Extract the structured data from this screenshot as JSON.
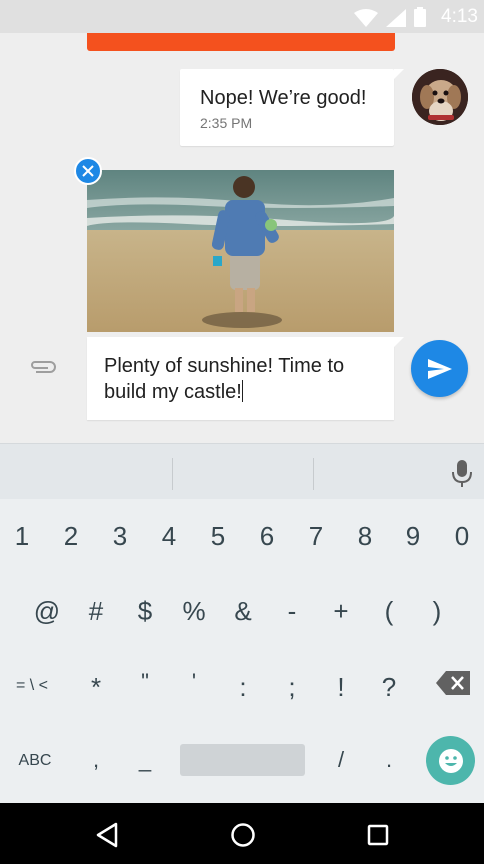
{
  "status_bar": {
    "time": "4:13"
  },
  "conversation": {
    "incoming": {
      "text": "Nope! We’re good!",
      "time": "2:35 PM"
    },
    "attachment": {
      "remove_icon": "close-icon"
    }
  },
  "composer": {
    "text": "Plenty of sunshine! Time to build my castle!",
    "attach_icon": "paperclip-icon",
    "send_icon": "send-icon"
  },
  "keyboard": {
    "row1": [
      "1",
      "2",
      "3",
      "4",
      "5",
      "6",
      "7",
      "8",
      "9",
      "0"
    ],
    "row2": [
      "@",
      "#",
      "$",
      "%",
      "&",
      "-",
      "+",
      "(",
      ")"
    ],
    "row3": [
      "= \\ <",
      "*",
      "\"",
      "'",
      ":",
      ";",
      "!",
      "?"
    ],
    "row4": {
      "abc": "ABC",
      "comma": ",",
      "underscore": "_",
      "slash": "/",
      "period": "."
    },
    "icons": {
      "mic": "mic-icon",
      "backspace": "backspace-icon",
      "emoji": "emoji-icon"
    }
  },
  "colors": {
    "accent_blue": "#1e88e5",
    "orange": "#f4511e",
    "emoji_teal": "#4db6ac"
  }
}
